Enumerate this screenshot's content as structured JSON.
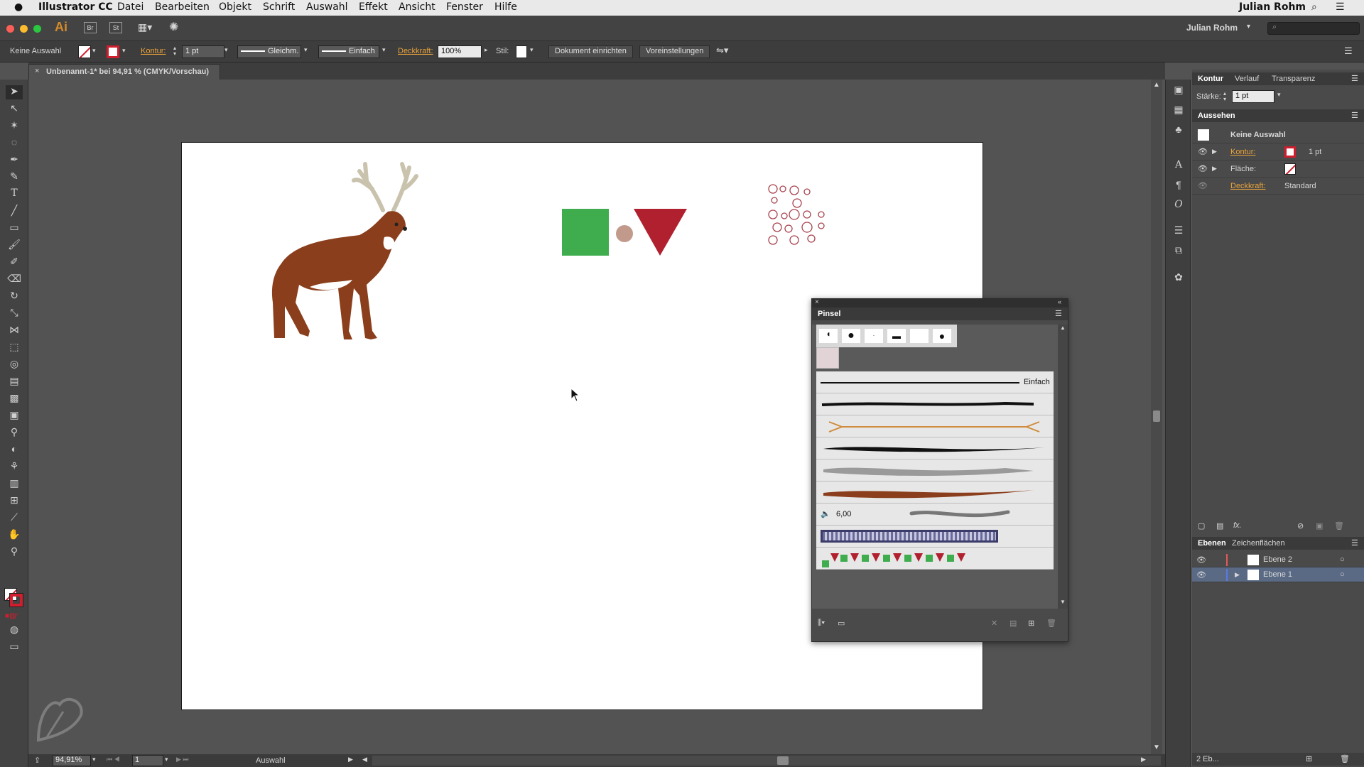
{
  "menubar": {
    "apple": "",
    "app": "Illustrator CC",
    "items": [
      "Datei",
      "Bearbeiten",
      "Objekt",
      "Schrift",
      "Auswahl",
      "Effekt",
      "Ansicht",
      "Fenster",
      "Hilfe"
    ],
    "user": "Julian Rohm"
  },
  "appbar": {
    "logo": "Ai",
    "br": "Br",
    "st": "St",
    "workspace_user": "Julian Rohm"
  },
  "control": {
    "selection": "Keine Auswahl",
    "kontur_label": "Kontur:",
    "kontur_value": "1 pt",
    "profile": "Gleichm.",
    "brush": "Einfach",
    "deckkraft_label": "Deckkraft:",
    "deckkraft_value": "100%",
    "stil_label": "Stil:",
    "doc_setup": "Dokument einrichten",
    "prefs": "Voreinstellungen"
  },
  "doctab": {
    "title": "Unbenannt-1* bei 94,91 % (CMYK/Vorschau)"
  },
  "status": {
    "zoom": "94,91%",
    "page": "1",
    "tool": "Auswahl"
  },
  "kontur_panel": {
    "tabs": [
      "Kontur",
      "Verlauf",
      "Transparenz"
    ],
    "staerke_label": "Stärke:",
    "staerke_value": "1 pt"
  },
  "aussehen": {
    "title": "Aussehen",
    "selection": "Keine Auswahl",
    "kontur_label": "Kontur:",
    "kontur_value": "1 pt",
    "flaeche_label": "Fläche:",
    "deckkraft_label": "Deckkraft:",
    "deckkraft_value": "Standard"
  },
  "ebenen": {
    "tabs": [
      "Ebenen",
      "Zeichenflächen"
    ],
    "layers": [
      "Ebene 2",
      "Ebene 1"
    ],
    "count": "2 Eb..."
  },
  "pinsel": {
    "title": "Pinsel",
    "brush_einfach": "Einfach",
    "brush_value": "6,00"
  },
  "colors": {
    "accent_red": "#b0202e",
    "green": "#3fad4e",
    "deer": "#8a3e1c",
    "antler": "#c9c3ad",
    "dot": "#c29a8b"
  }
}
